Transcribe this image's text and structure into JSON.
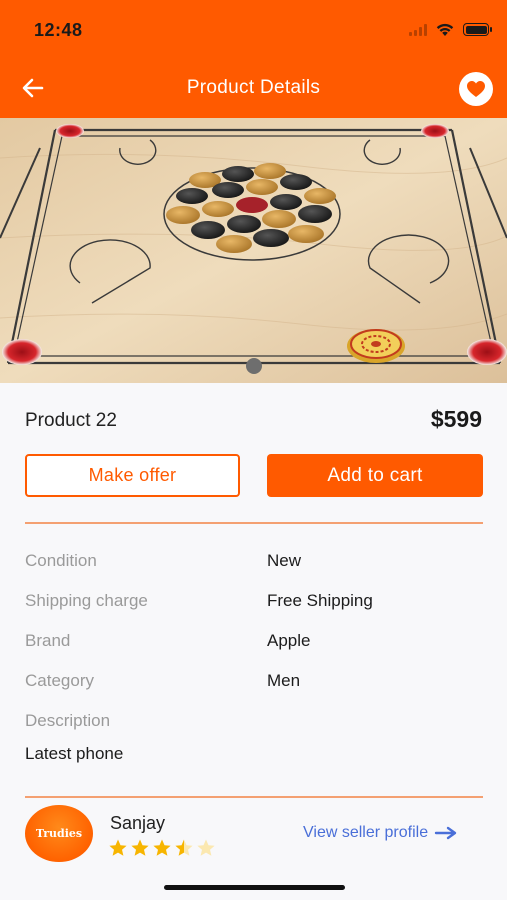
{
  "status_bar": {
    "time": "12:48"
  },
  "header": {
    "title": "Product Details",
    "back_icon": "arrow-left-icon",
    "favorite_icon": "heart-icon",
    "accent_color": "#ff5a00"
  },
  "product": {
    "name": "Product 22",
    "price": "$599",
    "image": "carrom-board-photo"
  },
  "actions": {
    "make_offer_label": "Make offer",
    "add_to_cart_label": "Add to cart"
  },
  "details": [
    {
      "label": "Condition",
      "value": "New"
    },
    {
      "label": "Shipping charge",
      "value": "Free Shipping"
    },
    {
      "label": "Brand",
      "value": "Apple"
    },
    {
      "label": "Category",
      "value": "Men"
    }
  ],
  "description": {
    "label": "Description",
    "value": "Latest phone"
  },
  "seller": {
    "avatar_text": "Trudies",
    "name": "Sanjay",
    "rating": 3.5,
    "rating_max": 5,
    "profile_link_label": "View seller profile",
    "link_icon": "arrow-right-icon",
    "link_color": "#4a6fd8"
  }
}
